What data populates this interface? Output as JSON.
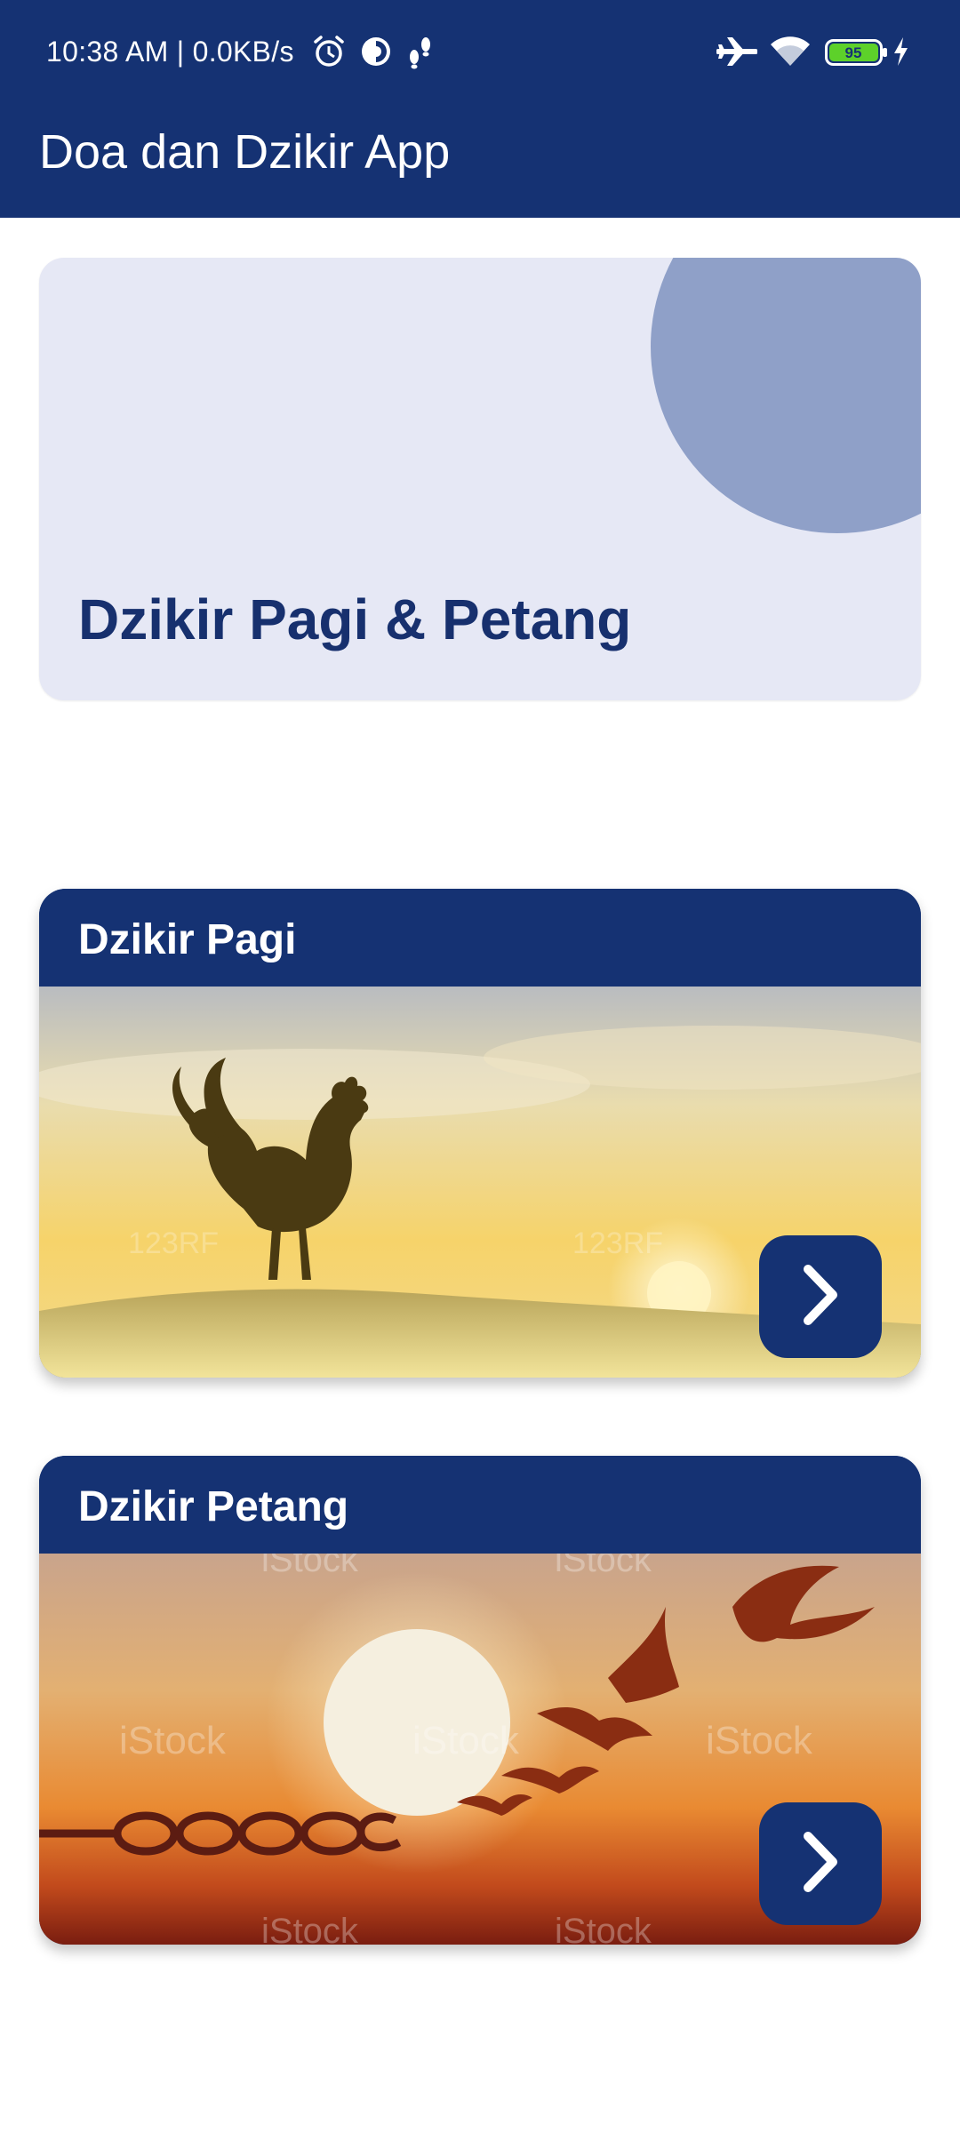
{
  "status_bar": {
    "time_network": "10:38 AM | 0.0KB/s",
    "battery_level": "95",
    "icons": [
      "alarm-icon",
      "data-saver-icon",
      "footsteps-icon",
      "airplane-mode-icon",
      "wifi-icon",
      "battery-icon",
      "charging-icon"
    ]
  },
  "app_bar": {
    "title": "Doa dan Dzikir App"
  },
  "hero": {
    "title": "Dzikir Pagi & Petang"
  },
  "cards": [
    {
      "title": "Dzikir Pagi",
      "button_icon": "chevron-right-icon"
    },
    {
      "title": "Dzikir Petang",
      "button_icon": "chevron-right-icon"
    }
  ],
  "colors": {
    "primary": "#153273",
    "hero_background": "#e6e8f5",
    "hero_circle": "#8fa0c8",
    "hero_title": "#17306e"
  }
}
